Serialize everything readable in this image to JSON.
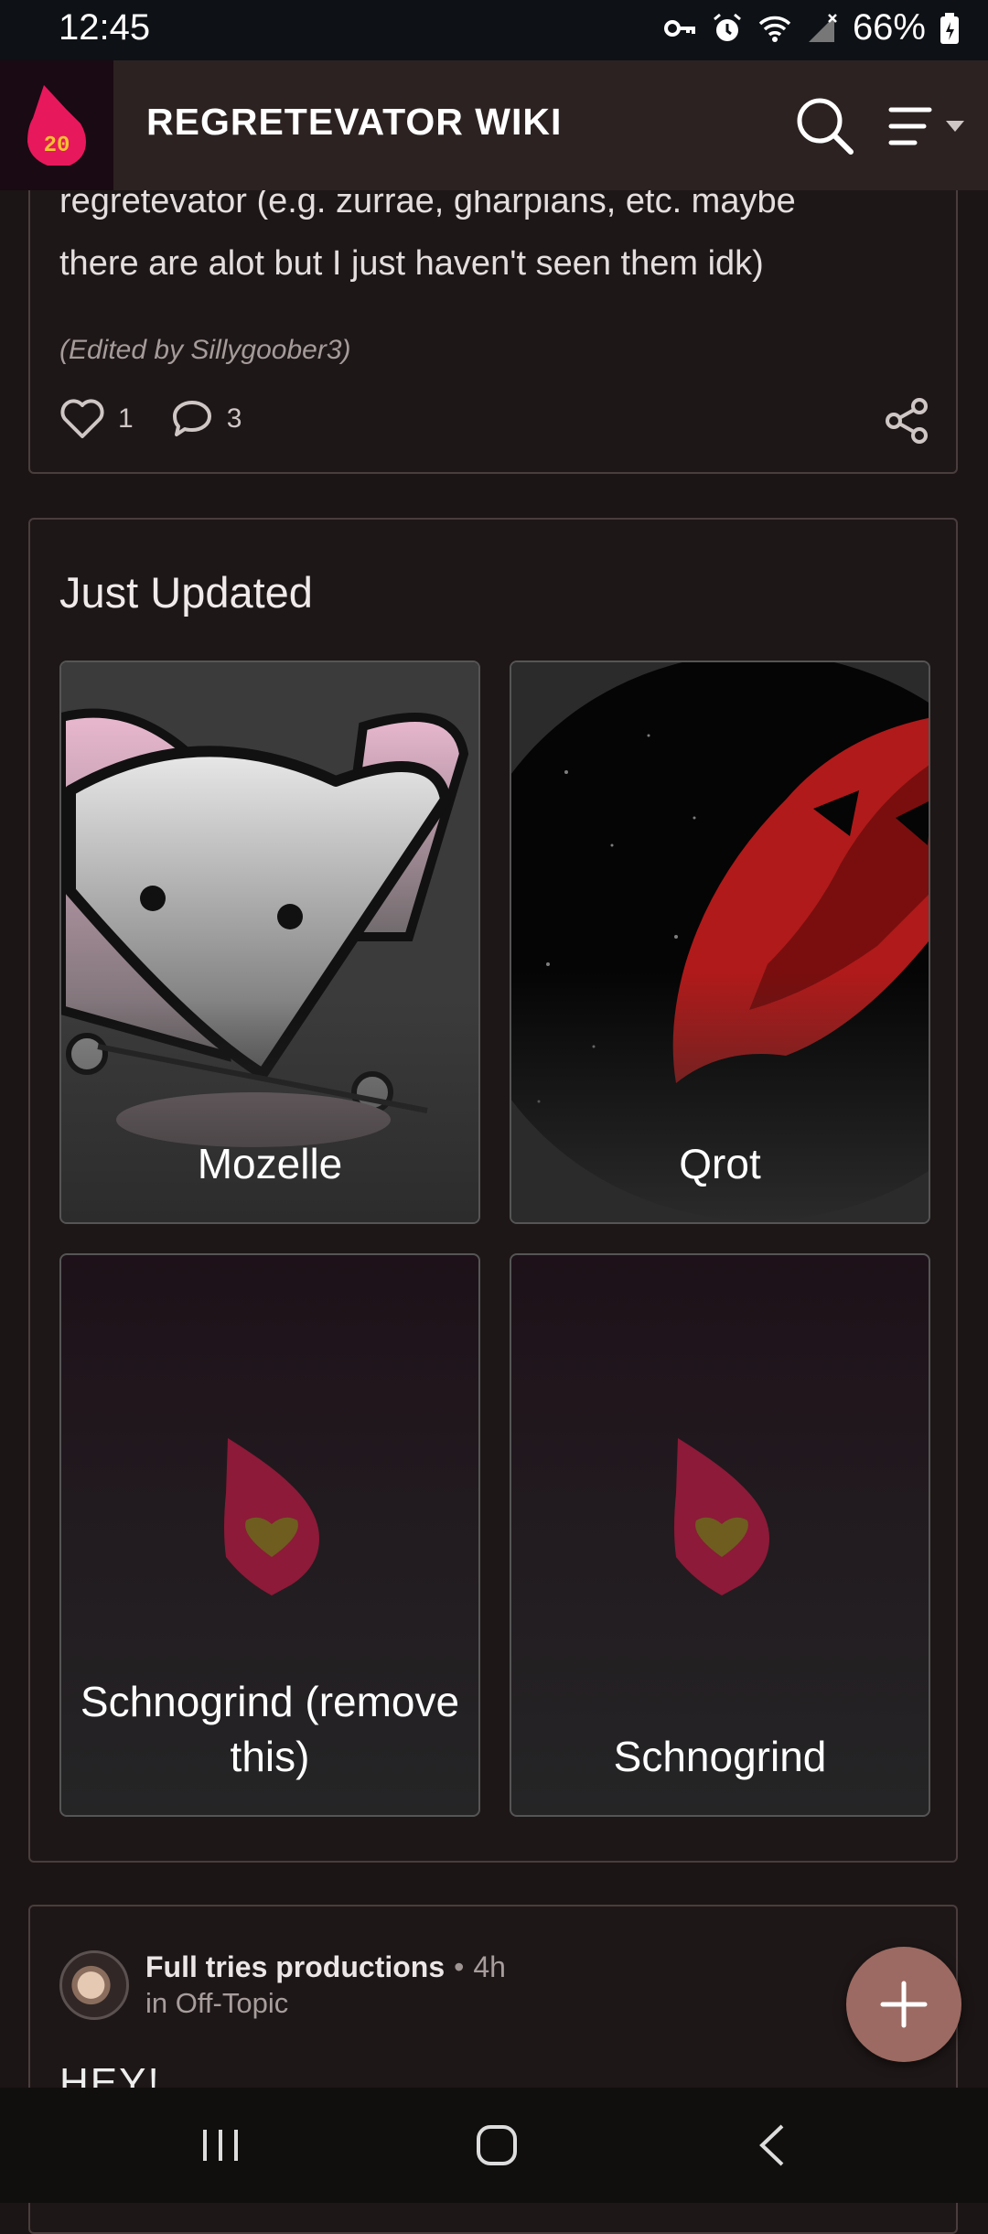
{
  "status_bar": {
    "time": "12:45",
    "battery": "66%"
  },
  "header": {
    "logo_text": "20",
    "title": "REGRETEVATOR WIKI"
  },
  "post": {
    "text_line1": "regretevator (e.g. zurrae, gharpians, etc. maybe",
    "text_line2": "there are alot but I just haven't seen them idk)",
    "edited": "(Edited by Sillygoober3)",
    "likes": "1",
    "comments": "3"
  },
  "just_updated": {
    "heading": "Just Updated",
    "items": [
      {
        "name": "Mozelle"
      },
      {
        "name": "Qrot"
      },
      {
        "name": "Schnogrind (remove this)"
      },
      {
        "name": "Schnogrind"
      }
    ]
  },
  "feed_post": {
    "author": "Full tries productions",
    "time": "4h",
    "category": "in Off-Topic",
    "text_start": "HEY!"
  },
  "colors": {
    "accent": "#9c6a62",
    "brand": "#e8185c",
    "background": "#1c1515"
  }
}
